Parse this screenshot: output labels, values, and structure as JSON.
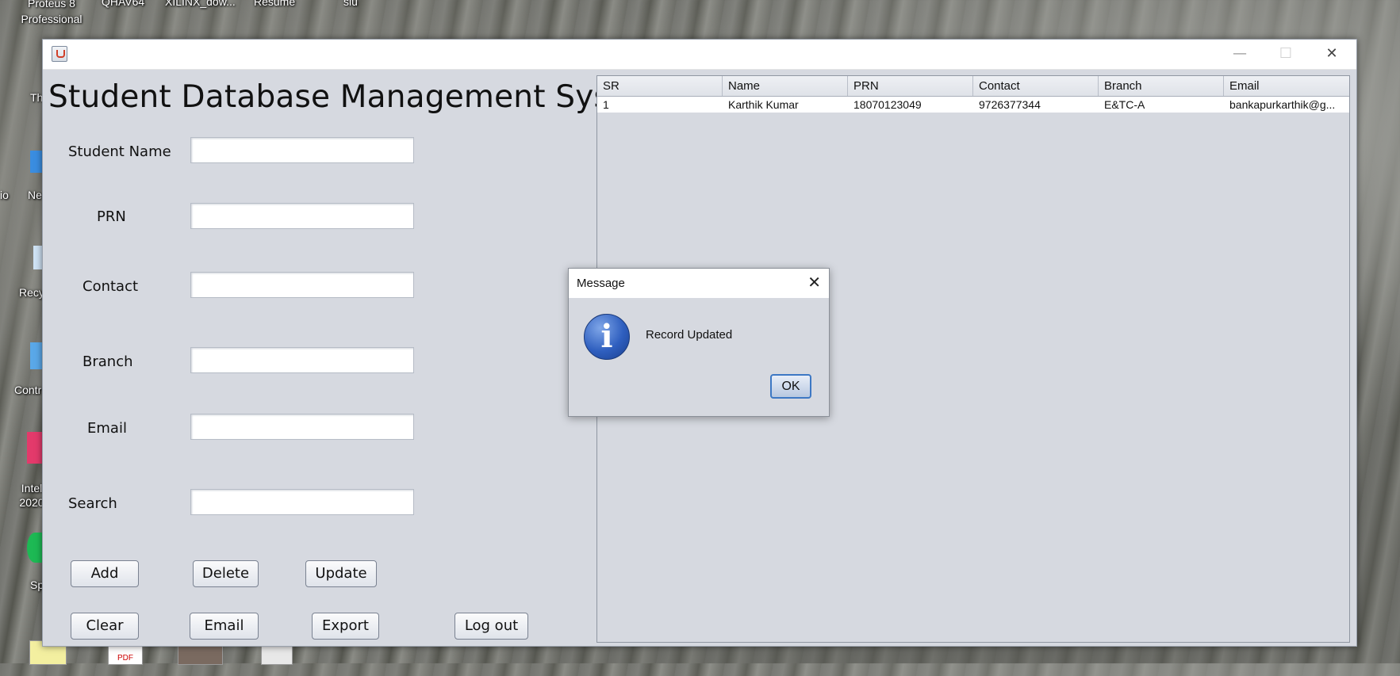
{
  "desktop": {
    "top_labels": [
      "Proteus 8 Professional",
      "QHAV64",
      "XILINX_dow...",
      "Resume",
      "siu"
    ],
    "left_labels": [
      "Th",
      "Ne",
      "Recy",
      "Contr",
      "Intel 2020",
      "Sp"
    ],
    "fragment_label": "io"
  },
  "window": {
    "title": "",
    "heading": "Student Database Management System",
    "controls": {
      "minimize": "—",
      "maximize": "☐",
      "close": "✕"
    }
  },
  "form": {
    "student_name_label": "Student Name",
    "student_name_value": "",
    "prn_label": "PRN",
    "prn_value": "",
    "contact_label": "Contact",
    "contact_value": "",
    "branch_label": "Branch",
    "branch_value": "",
    "email_label": "Email",
    "email_value": "",
    "search_label": "Search",
    "search_value": ""
  },
  "buttons": {
    "add": "Add",
    "delete": "Delete",
    "update": "Update",
    "clear": "Clear",
    "email": "Email",
    "export": "Export",
    "logout": "Log out"
  },
  "table": {
    "columns": [
      "SR",
      "Name",
      "PRN",
      "Contact",
      "Branch",
      "Email"
    ],
    "rows": [
      [
        "1",
        "Karthik Kumar",
        "18070123049",
        "9726377344",
        "E&TC-A",
        "bankapurkarthik@g..."
      ]
    ]
  },
  "dialog": {
    "title": "Message",
    "close": "✕",
    "message": "Record Updated",
    "ok": "OK",
    "icon": "i"
  },
  "taskbar": {
    "pdf_label": "PDF"
  }
}
